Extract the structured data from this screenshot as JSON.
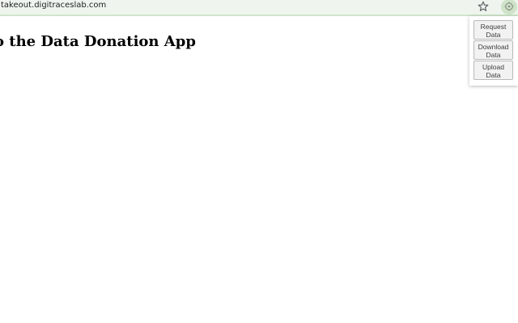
{
  "browser": {
    "url": "takeout.digitraceslab.com",
    "icons": {
      "bookmark": "star-icon",
      "extension": "puzzle-extension-icon"
    },
    "colors": {
      "toolbar_bg": "#eff5ee",
      "toolbar_border": "#cfe6cb",
      "extension_bg": "#cfe3c9"
    }
  },
  "page": {
    "title": "o the Data Donation App"
  },
  "popup": {
    "buttons": [
      {
        "line1": "Request",
        "line2": "Data"
      },
      {
        "line1": "Download",
        "line2": "Data"
      },
      {
        "line1": "Upload",
        "line2": "Data"
      }
    ]
  }
}
